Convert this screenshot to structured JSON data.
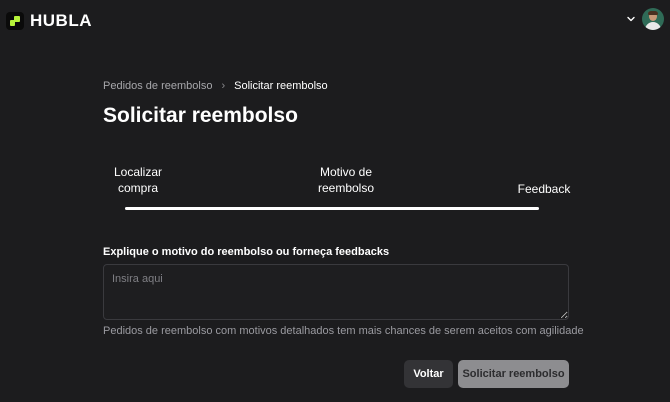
{
  "header": {
    "brand": "HUBLA",
    "logo_icon": "hubla-logo-icon",
    "menu_icon": "chevron-down-icon",
    "avatar_icon": "user-avatar"
  },
  "breadcrumb": {
    "parent": "Pedidos de reembolso",
    "separator": "›",
    "current": "Solicitar reembolso"
  },
  "page": {
    "title": "Solicitar reembolso"
  },
  "stepper": {
    "steps": [
      {
        "line1": "Localizar",
        "line2": "compra"
      },
      {
        "line1": "Motivo de",
        "line2": "reembolso"
      },
      {
        "line1": "Feedback",
        "line2": ""
      }
    ],
    "progress_percent": 100
  },
  "form": {
    "label": "Explique o motivo do reembolso ou forneça feedbacks",
    "placeholder": "Insira aqui",
    "value": "",
    "hint": "Pedidos de reembolso com motivos detalhados tem mais chances de serem aceitos com agilidade"
  },
  "actions": {
    "back_label": "Voltar",
    "submit_label": "Solicitar reembolso"
  },
  "colors": {
    "background": "#1c1c1e",
    "brand_accent": "#b6f23a",
    "submit_disabled": "#8d8d90"
  }
}
